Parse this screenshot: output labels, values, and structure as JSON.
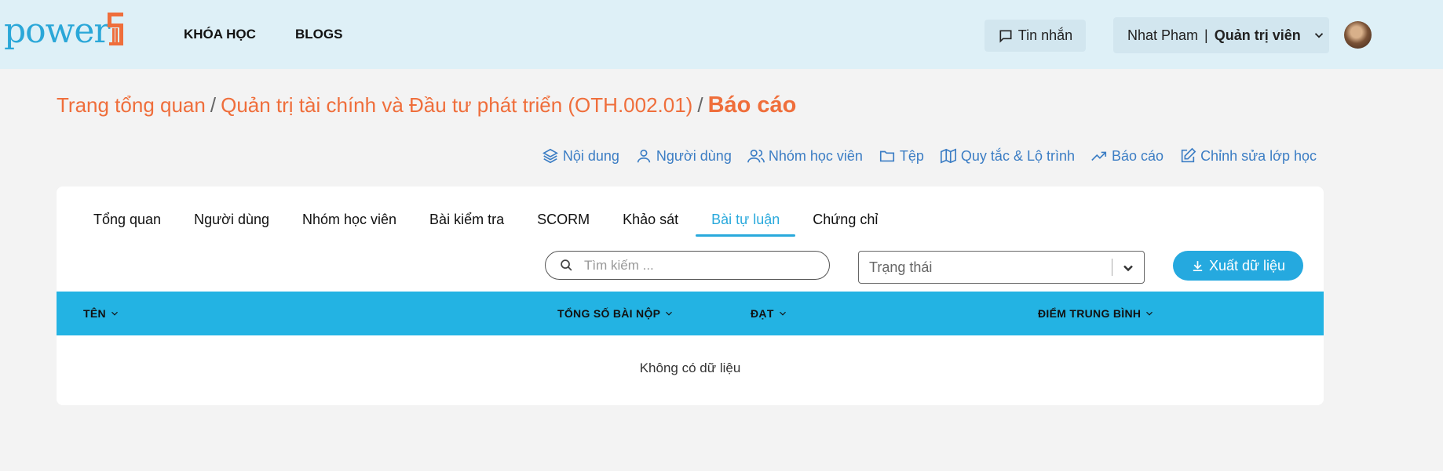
{
  "brand": {
    "logo_text": "power",
    "logo_accent": "#ef6e3b",
    "logo_color": "#2aa7d8"
  },
  "nav": {
    "courses": "KHÓA HỌC",
    "blogs": "BLOGS"
  },
  "messages": {
    "label": "Tin nhắn",
    "icon": "message-icon"
  },
  "user": {
    "name": "Nhat Pham",
    "separator": "|",
    "role": "Quản trị viên"
  },
  "breadcrumb": {
    "home": "Trang tổng quan",
    "course": "Quản trị tài chính và Đầu tư phát triển (OTH.002.01)",
    "current": "Báo cáo",
    "separator": "/"
  },
  "actions": [
    {
      "label": "Nội dung",
      "icon": "layers-icon"
    },
    {
      "label": "Người dùng",
      "icon": "user-icon"
    },
    {
      "label": "Nhóm học viên",
      "icon": "users-icon"
    },
    {
      "label": "Tệp",
      "icon": "folder-icon"
    },
    {
      "label": "Quy tắc & Lộ trình",
      "icon": "map-icon"
    },
    {
      "label": "Báo cáo",
      "icon": "trending-icon"
    },
    {
      "label": "Chỉnh sửa lớp học",
      "icon": "edit-icon"
    }
  ],
  "tabs": [
    {
      "label": "Tổng quan"
    },
    {
      "label": "Người dùng"
    },
    {
      "label": "Nhóm học viên"
    },
    {
      "label": "Bài kiểm tra"
    },
    {
      "label": "SCORM"
    },
    {
      "label": "Khảo sát"
    },
    {
      "label": "Bài tự luận",
      "active": true
    },
    {
      "label": "Chứng chỉ"
    }
  ],
  "filters": {
    "search_placeholder": "Tìm kiếm ...",
    "status_placeholder": "Trạng thái",
    "export_label": "Xuất dữ liệu"
  },
  "table": {
    "columns": [
      "TÊN",
      "TỔNG SỐ BÀI NỘP",
      "ĐẠT",
      "ĐIỂM TRUNG BÌNH"
    ],
    "empty_text": "Không có dữ liệu"
  },
  "colors": {
    "accent": "#25a9df",
    "breadcrumb": "#ef6e3b",
    "action_link": "#3b7dc4",
    "header_bg": "#def0f7"
  }
}
